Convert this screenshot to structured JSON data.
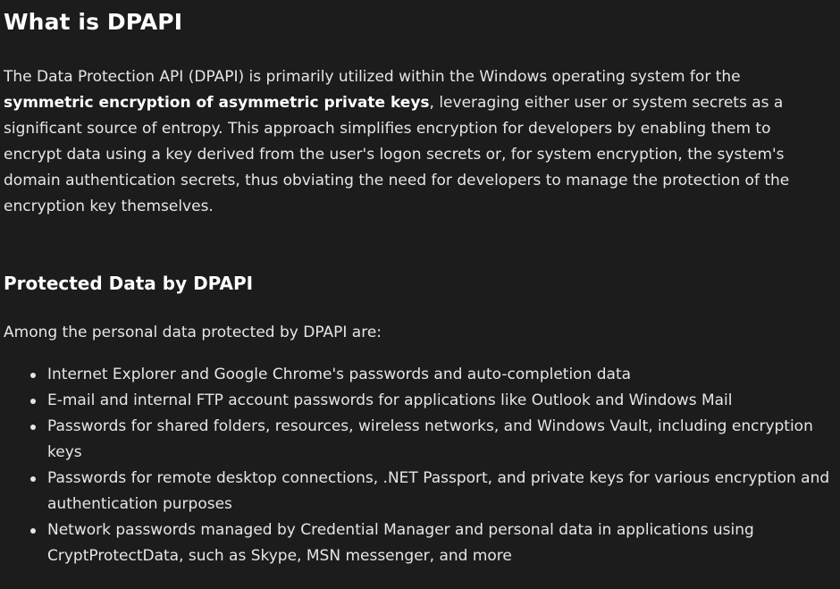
{
  "article": {
    "title": "What is DPAPI",
    "intro": {
      "before": "The Data Protection API (DPAPI) is primarily utilized within the Windows operating system for the ",
      "bold": "symmetric encryption of asymmetric private keys",
      "after": ", leveraging either user or system secrets as a significant source of entropy. This approach simplifies encryption for developers by enabling them to encrypt data using a key derived from the user's logon secrets or, for system encryption, the system's domain authentication secrets, thus obviating the need for developers to manage the protection of the encryption key themselves."
    },
    "section": {
      "heading": "Protected Data by DPAPI",
      "lead": "Among the personal data protected by DPAPI are:",
      "items": [
        "Internet Explorer and Google Chrome's passwords and auto-completion data",
        "E-mail and internal FTP account passwords for applications like Outlook and Windows Mail",
        "Passwords for shared folders, resources, wireless networks, and Windows Vault, including encryption keys",
        "Passwords for remote desktop connections, .NET Passport, and private keys for various encryption and authentication purposes",
        "Network passwords managed by Credential Manager and personal data in applications using CryptProtectData, such as Skype, MSN messenger, and more"
      ]
    }
  }
}
